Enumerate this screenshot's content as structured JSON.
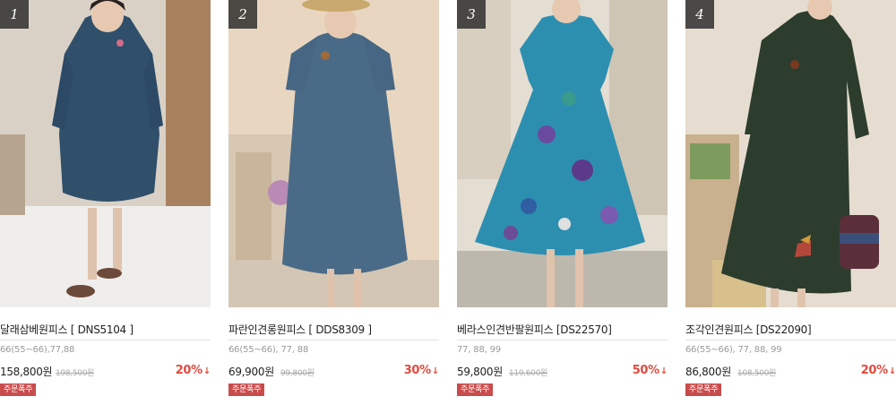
{
  "products": [
    {
      "rank": "1",
      "name": "달래삼베원피스 [ DNS5104 ]",
      "sizes": "66(55~66),77,88",
      "price": "158,800원",
      "original_price": "198,500원",
      "discount": "20%",
      "badge": "주문폭주"
    },
    {
      "rank": "2",
      "name": "파란인견롱원피스 [ DDS8309 ]",
      "sizes": "66(55~66), 77, 88",
      "price": "69,900원",
      "original_price": "99,800원",
      "discount": "30%",
      "badge": "주문폭주"
    },
    {
      "rank": "3",
      "name": "베라스인견반팔원피스 [DS22570]",
      "sizes": "77, 88, 99",
      "price": "59,800원",
      "original_price": "119,600원",
      "discount": "50%",
      "badge": "주문폭주"
    },
    {
      "rank": "4",
      "name": "조각인견원피스 [DS22090]",
      "sizes": "66(55~66), 77, 88, 99",
      "price": "86,800원",
      "original_price": "108,500원",
      "discount": "20%",
      "badge": "주문폭주"
    }
  ],
  "icons": {
    "discount_arrow": "arrow-down-icon"
  },
  "colors": {
    "discount": "#e04a3f",
    "badge_bg": "#c94c4c",
    "rank_bg": "#282828"
  }
}
